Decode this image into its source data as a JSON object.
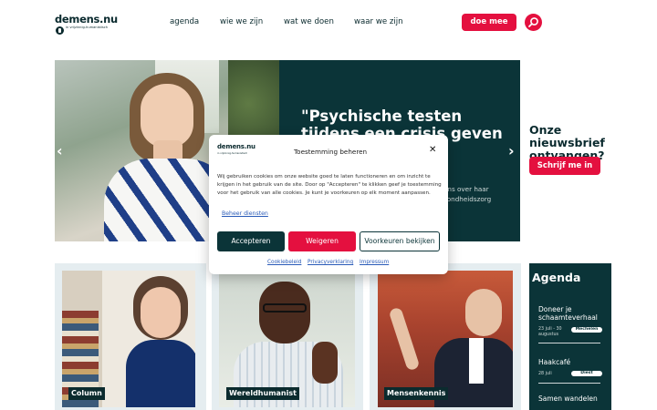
{
  "header": {
    "logo_text": "demens.nu",
    "logo_tagline": "in vrijzinnig-humanistisch",
    "nav": [
      "agenda",
      "wie we zijn",
      "wat we doen",
      "waar we zijn"
    ],
    "cta_label": "doe mee",
    "search_icon": "search-icon"
  },
  "hero": {
    "title": "\"Psychische testen tijdens een crisis geven een valse",
    "text": "ens over haar\nzondheidszorg",
    "prev_icon": "chevron-left-icon",
    "next_icon": "chevron-right-icon"
  },
  "newsletter": {
    "title": "Onze nieuwsbrief ontvangen?",
    "button": "Schrijf me in"
  },
  "cards": [
    {
      "label": "Column"
    },
    {
      "label": "Wereldhumanist"
    },
    {
      "label": "Mensenkennis"
    }
  ],
  "agenda": {
    "title": "Agenda",
    "items": [
      {
        "title": "Doneer je schaamteverhaal",
        "date": "23 juli - 30 augustus",
        "place": "Mechelen"
      },
      {
        "title": "Haakcafé",
        "date": "28 juli",
        "place": "Diest"
      },
      {
        "title": "Samen wandelen",
        "date": "",
        "place": ""
      }
    ]
  },
  "cookie": {
    "logo_text": "demens.nu",
    "logo_tagline": "in vrijzinnig-humanistisch",
    "title": "Toestemming beheren",
    "body": "Wij gebruiken cookies om onze website goed te laten functioneren en om inzicht te krijgen in het gebruik van de site. Door op \"Accepteren\" te klikken geef je toestemming voor het gebruik van alle cookies. Je kunt je voorkeuren op elk moment aanpassen.",
    "manage_link": "Beheer diensten",
    "accept": "Accepteren",
    "deny": "Weigeren",
    "preferences": "Voorkeuren bekijken",
    "footer_links": [
      "Cookiebeleid",
      "Privacyverklaring",
      "Impressum"
    ],
    "colors": {
      "primary": "#0b3438",
      "accent": "#e4103f"
    }
  }
}
